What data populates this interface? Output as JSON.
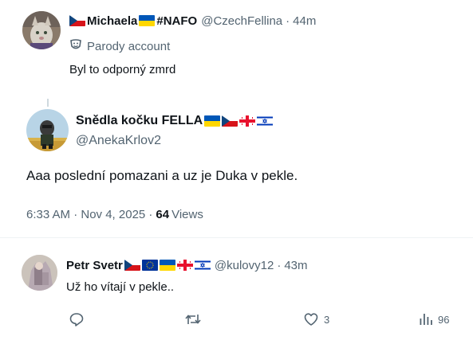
{
  "reply1": {
    "display_name": "Michaela",
    "name_suffix": "#NAFO",
    "handle": "@CzechFellina",
    "separator": "·",
    "time": "44m",
    "badge": "Parody account",
    "text": "Byl to odporný zmrd"
  },
  "main_post": {
    "display_name": "Snědla kočku FELLA",
    "handle": "@AnekaKrlov2",
    "text": "Aaa poslední pomazani a uz je Duka v pekle.",
    "timestamp": "6:33 AM · Nov 4, 2025 ·",
    "views_count": "64",
    "views_label": "Views"
  },
  "reply2": {
    "display_name": "Petr Svetr",
    "handle": "@kulovy12",
    "separator": "·",
    "time": "43m",
    "text": "Už ho vítají v pekle..",
    "actions": {
      "reply_count": "",
      "repost_count": "",
      "like_count": "3",
      "views_count": "96"
    }
  },
  "colors": {
    "text_primary": "#0f1419",
    "text_secondary": "#536471",
    "divider": "#eff3f4"
  }
}
